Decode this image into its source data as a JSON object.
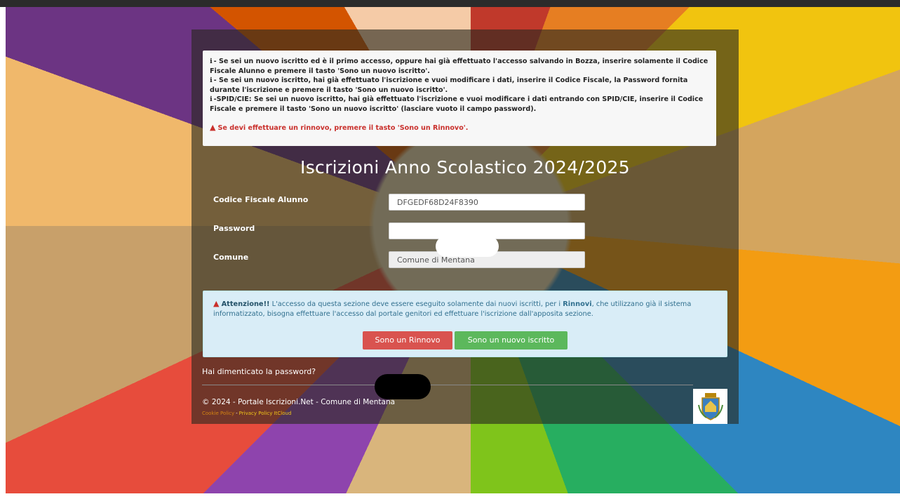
{
  "info": {
    "line1": "- Se sei un nuovo iscritto ed è il primo accesso, oppure hai già effettuato l'accesso salvando in Bozza, inserire solamente il Codice Fiscale Alunno e premere il tasto 'Sono un nuovo iscritto'.",
    "line2": "- Se sei un nuovo iscritto, hai già effettuato l'iscrizione e vuoi modificare i dati, inserire il Codice Fiscale, la Password fornita durante l'iscrizione e premere il tasto 'Sono un nuovo iscritto'.",
    "line3": "-SPID/CIE: Se sei un nuovo iscritto, hai già effettuato l'iscrizione e vuoi modificare i dati entrando con SPID/CIE, inserire il Codice Fiscale e premere il tasto 'Sono un nuovo iscritto' (lasciare vuoto il campo password).",
    "warning": "Se devi effettuare un rinnovo, premere il tasto 'Sono un Rinnovo'."
  },
  "title": "Iscrizioni Anno Scolastico 2024/2025",
  "form": {
    "codice_label": "Codice Fiscale Alunno",
    "codice_value": "DFGEDF68D24F8390",
    "password_label": "Password",
    "password_value": "",
    "comune_label": "Comune",
    "comune_value": "Comune di Mentana"
  },
  "alert": {
    "attention": "Attenzione!!",
    "text1": " L'accesso da questa sezione deve essere eseguito solamente dai nuovi iscritti, per i ",
    "rinnovi": "Rinnovi",
    "text2": ", che utilizzano già il sistema informatizzato, bisogna effettuare l'accesso dal portale genitori ed effettuare l'iscrizione dall'apposita sezione."
  },
  "buttons": {
    "rinnovo": "Sono un Rinnovo",
    "nuovo": "Sono un nuovo iscritto"
  },
  "forgot_password": "Hai dimenticato la password?",
  "footer": {
    "copyright": "© 2024 - Portale Iscrizioni.Net - Comune di Mentana",
    "cookie": "Cookie Policy",
    "sep": "-",
    "privacy": "Privacy Policy ItCloud"
  },
  "colors": {
    "danger": "#d9534f",
    "success": "#5cb85c",
    "info_bg": "#d9edf7"
  }
}
